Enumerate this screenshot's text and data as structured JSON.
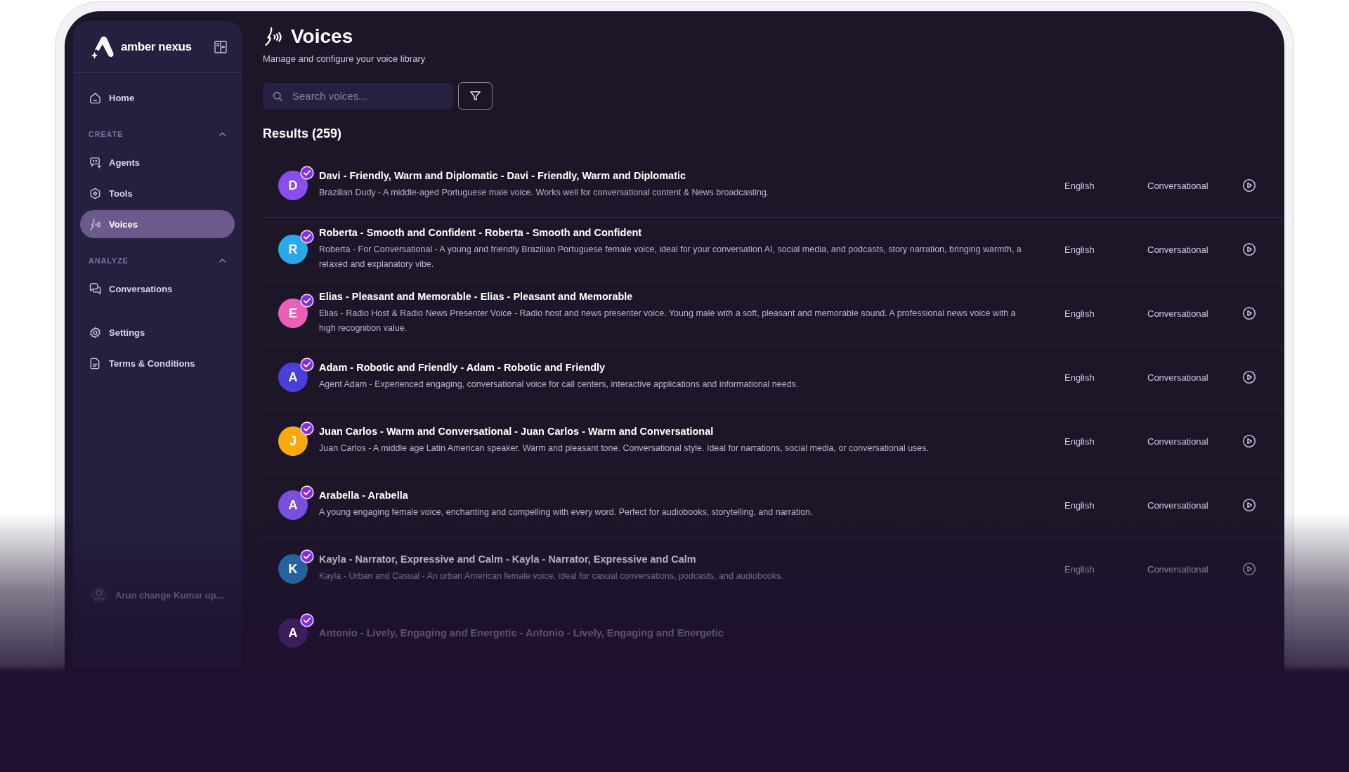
{
  "brand": {
    "name": "amber nexus"
  },
  "sidebar": {
    "items": [
      {
        "kind": "link",
        "label": "Home",
        "selected": false
      },
      {
        "kind": "section",
        "label": "CREATE",
        "expanded": true,
        "children": [
          {
            "label": "Agents",
            "selected": false
          },
          {
            "label": "Tools",
            "selected": false
          },
          {
            "label": "Voices",
            "selected": true
          }
        ]
      },
      {
        "kind": "section",
        "label": "ANALYZE",
        "expanded": true,
        "children": [
          {
            "label": "Conversations",
            "selected": false
          }
        ]
      },
      {
        "kind": "gap"
      },
      {
        "kind": "link",
        "label": "Settings",
        "selected": false
      },
      {
        "kind": "link",
        "label": "Terms & Conditions",
        "selected": false
      }
    ],
    "user": {
      "name": "Arun change Kumar up..."
    }
  },
  "page": {
    "title": "Voices",
    "subtitle": "Manage and configure your voice library"
  },
  "search": {
    "placeholder": "Search voices..."
  },
  "results": {
    "heading": "Results (259)"
  },
  "voices": [
    {
      "initial": "D",
      "color": "#8b4cf0",
      "verified": true,
      "name": "Davi - Friendly, Warm and Diplomatic - Davi - Friendly, Warm and Diplomatic",
      "description": "Brazilian Dudy - A middle-aged Portuguese male voice. Works well for conversational content & News broadcasting.",
      "language": "English",
      "category": "Conversational"
    },
    {
      "initial": "R",
      "color": "#2aa8ea",
      "verified": true,
      "name": "Roberta - Smooth and Confident - Roberta - Smooth and Confident",
      "description": "Roberta - For Conversational - A young and friendly Brazilian Portuguese female voice, ideal for your conversation AI, social media, and podcasts, story narration, bringing warmth, a relaxed and explanatory vibe.",
      "language": "English",
      "category": "Conversational"
    },
    {
      "initial": "E",
      "color": "#ec5fb8",
      "verified": true,
      "name": "Elias - Pleasant and Memorable - Elias - Pleasant and Memorable",
      "description": "Elias - Radio Host & Radio News Presenter Voice - Radio host and news presenter voice. Young male with a soft, pleasant and memorable sound. A professional news voice with a high recognition value.",
      "language": "English",
      "category": "Conversational"
    },
    {
      "initial": "A",
      "color": "#4b3fd9",
      "verified": true,
      "name": "Adam - Robotic and Friendly - Adam - Robotic and Friendly",
      "description": "Agent Adam - Experienced engaging, conversational voice for call centers, interactive applications and informational needs.",
      "language": "English",
      "category": "Conversational"
    },
    {
      "initial": "J",
      "color": "#f8a90f",
      "verified": true,
      "name": "Juan Carlos - Warm and Conversational - Juan Carlos - Warm and Conversational",
      "description": "Juan Carlos - A middle age Latin American speaker. Warm and pleasant tone. Conversational style. Ideal for narrations, social media, or conversational uses.",
      "language": "English",
      "category": "Conversational"
    },
    {
      "initial": "A",
      "color": "#7a4fe0",
      "verified": true,
      "name": "Arabella - Arabella",
      "description": "A young engaging female voice, enchanting and compelling with every word. Perfect for audiobooks, storytelling, and narration.",
      "language": "English",
      "category": "Conversational"
    },
    {
      "initial": "K",
      "color": "#2762a0",
      "verified": true,
      "name": "Kayla - Narrator, Expressive and Calm - Kayla - Narrator, Expressive and Calm",
      "description": "Kayla - Urban and Casual - An urban American female voice, ideal for casual conversations, podcasts, and audiobooks.",
      "language": "English",
      "category": "Conversational"
    },
    {
      "initial": "A",
      "color": "#3c1d5c",
      "verified": true,
      "name": "Antonio - Lively, Engaging and Energetic - Antonio - Lively, Engaging and Energetic"
    }
  ]
}
